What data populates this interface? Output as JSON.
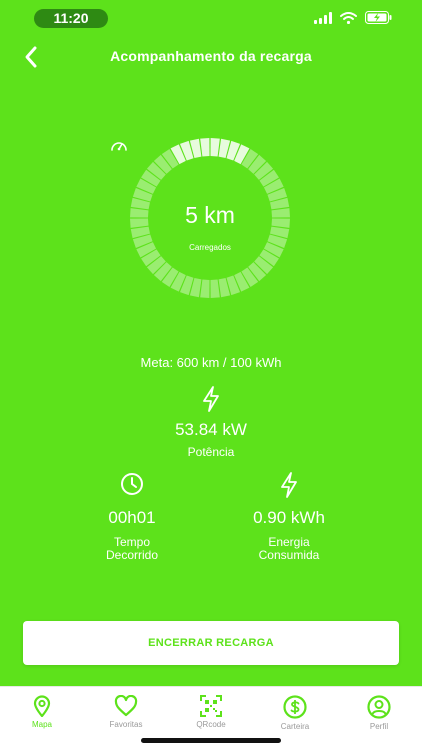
{
  "status": {
    "time": "11:20"
  },
  "header": {
    "title": "Acompanhamento da recarga"
  },
  "gauge": {
    "value": "5 km",
    "label": "Carregados",
    "progress": 0.08,
    "segments": 48
  },
  "meta": "Meta: 600 km / 100 kWh",
  "power": {
    "value": "53.84 kW",
    "label": "Potência"
  },
  "elapsed": {
    "value": "00h01",
    "label_line1": "Tempo",
    "label_line2": "Decorrido"
  },
  "energy": {
    "value": "0.90 kWh",
    "label_line1": "Energia",
    "label_line2": "Consumida"
  },
  "actions": {
    "end_label": "ENCERRAR RECARGA"
  },
  "tabs": [
    {
      "label": "Mapa",
      "icon": "map-pin-icon",
      "active": true
    },
    {
      "label": "Favoritas",
      "icon": "heart-icon",
      "active": false
    },
    {
      "label": "QRcode",
      "icon": "qrcode-icon",
      "active": false
    },
    {
      "label": "Carteira",
      "icon": "dollar-icon",
      "active": false
    },
    {
      "label": "Perfil",
      "icon": "user-icon",
      "active": false
    }
  ],
  "colors": {
    "brand": "#5de21b",
    "white": "#ffffff",
    "dark_pill": "#2e8a13"
  }
}
